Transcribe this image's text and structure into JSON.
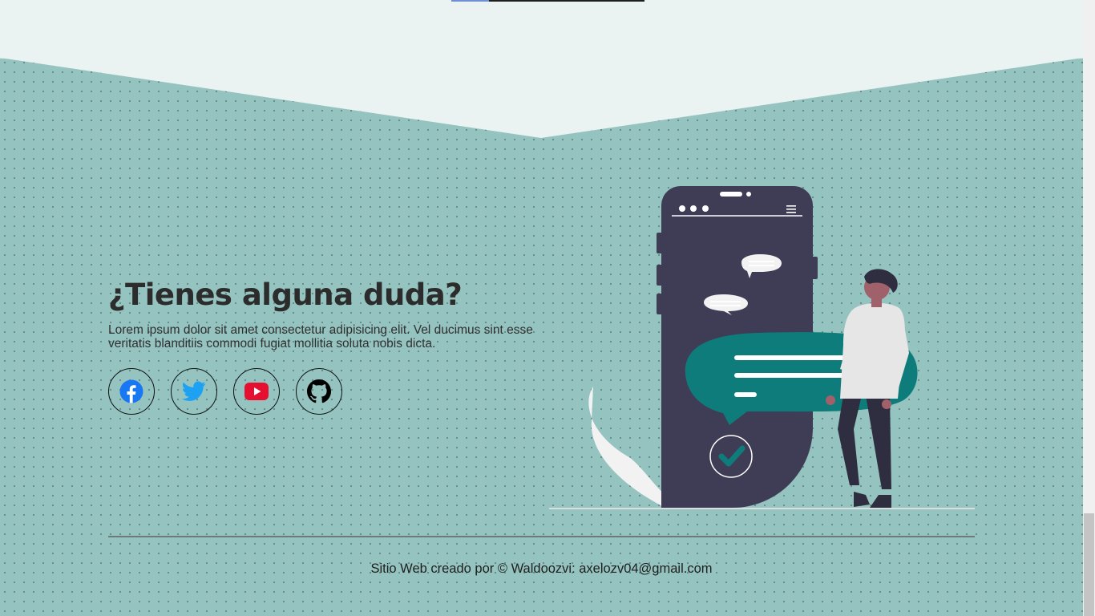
{
  "contact": {
    "heading": "¿Tienes alguna duda?",
    "description": "Lorem ipsum dolor sit amet consectetur adipisicing elit. Vel ducimus sint esse veritatis blanditiis commodi fugiat mollitia soluta nobis dicta."
  },
  "socials": [
    {
      "icon": "facebook-icon",
      "color": "#1877f2"
    },
    {
      "icon": "twitter-icon",
      "color": "#1da1f2"
    },
    {
      "icon": "youtube-icon",
      "color": "#ff0000"
    },
    {
      "icon": "github-icon",
      "color": "#000000"
    }
  ],
  "footer": {
    "credit": "Sitio Web creado por © Waldoozvi: axelozv04@gmail.com"
  },
  "colors": {
    "background": "#95c4c0",
    "top_band": "#ebf3f2",
    "accent": "#0e7c7b",
    "phone": "#3f3d56"
  }
}
